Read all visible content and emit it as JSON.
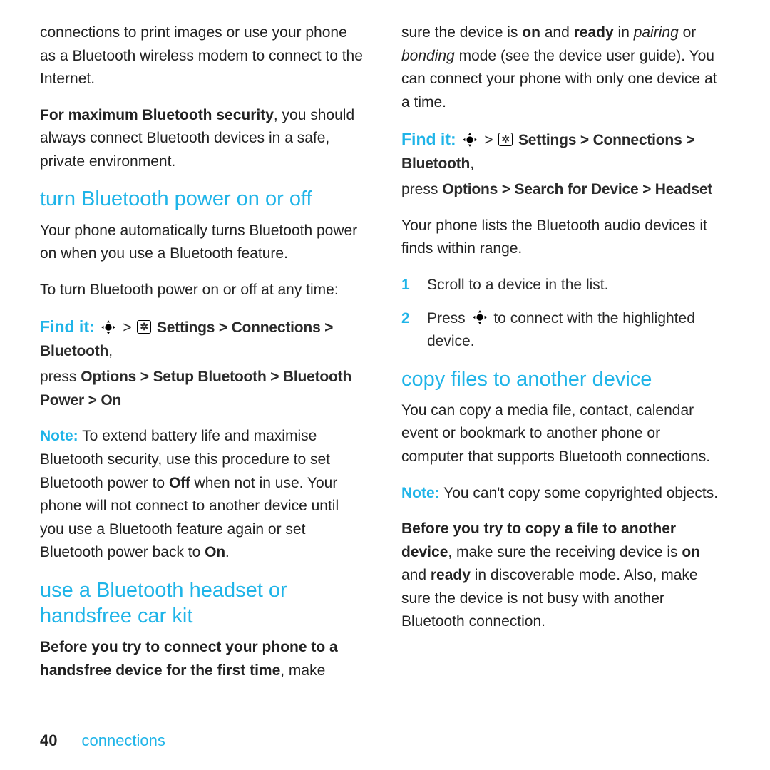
{
  "left": {
    "intro": "connections to print images or use your phone as a Bluetooth wireless modem to connect to the Internet.",
    "security_bold": "For maximum Bluetooth security",
    "security_rest": ", you should always connect Bluetooth devices in a safe, private environment.",
    "h_turn": "turn Bluetooth power on or off",
    "turn_p1": "Your phone automatically turns Bluetooth power on when you use a Bluetooth feature.",
    "turn_p2": "To turn Bluetooth power on or off at any time:",
    "findit_label": "Find it:",
    "findit_path": " Settings > Connections > Bluetooth",
    "findit_sub_pre": "press ",
    "findit_sub_bold": "Options > Setup Bluetooth > Bluetooth Power > On",
    "note_label": "Note:",
    "note_text_pre": " To extend battery life and maximise Bluetooth security, use this procedure to set Bluetooth power to ",
    "note_off": "Off",
    "note_text_mid": " when not in use. Your phone will not connect to another device until you use a Bluetooth feature again or set Bluetooth power back to ",
    "note_on": "On",
    "note_period": ".",
    "h_headset": "use a Bluetooth headset or handsfree car kit",
    "headset_bold": "Before you try to connect your phone to a handsfree device for the first time",
    "headset_rest": ", make"
  },
  "right": {
    "top_pre": "sure the device is ",
    "top_on": "on",
    "top_and": " and ",
    "top_ready": "ready",
    "top_in": " in ",
    "top_pairing": "pairing",
    "top_or": " or ",
    "top_bonding": "bonding",
    "top_rest": " mode (see the device user guide). You can connect your phone with only one device at a time.",
    "findit_label": "Find it:",
    "findit_path": " Settings > Connections > Bluetooth",
    "findit_sub_pre": "press ",
    "findit_sub_bold": "Options > Search for Device > Headset",
    "list_intro": "Your phone lists the Bluetooth audio devices it finds within range.",
    "step1": "Scroll to a device in the list.",
    "step2_pre": "Press ",
    "step2_post": " to connect with the highlighted device.",
    "h_copy": "copy files to another device",
    "copy_p1": "You can copy a media file, contact, calendar event or bookmark to another phone or computer that supports Bluetooth connections.",
    "note_label": "Note:",
    "note_text": " You can't copy some copyrighted objects.",
    "before_bold": "Before you try to copy a file to another device",
    "before_mid1": ", make sure the receiving device is ",
    "before_on": "on",
    "before_mid2": " and ",
    "before_ready": "ready",
    "before_rest": " in discoverable mode. Also, make sure the device is not busy with another Bluetooth connection."
  },
  "footer": {
    "page": "40",
    "section": "connections"
  },
  "icons": {
    "nav": "nav-icon",
    "gear": "✲"
  }
}
